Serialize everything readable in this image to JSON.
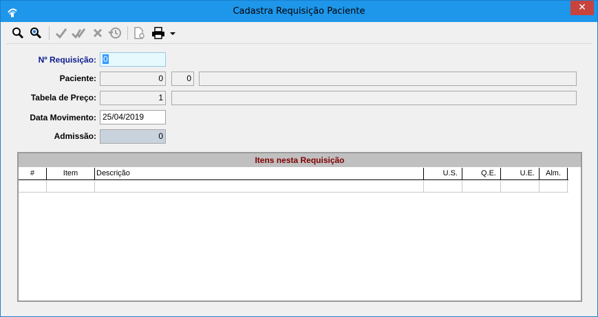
{
  "window": {
    "title": "Cadastra Requisição Paciente",
    "close_glyph": "✕"
  },
  "toolbar": {
    "icons": [
      "search-icon",
      "search-advanced-icon",
      "confirm-icon",
      "confirm-all-icon",
      "cancel-icon",
      "history-icon",
      "new-document-icon",
      "print-icon",
      "dropdown-arrow-icon"
    ]
  },
  "form": {
    "requisicao": {
      "label": "Nº Requisição:",
      "value": "0"
    },
    "paciente": {
      "label": "Paciente:",
      "code": "0",
      "code2": "0",
      "name": ""
    },
    "tabela_preco": {
      "label": "Tabela de Preço:",
      "code": "1",
      "name": ""
    },
    "data_movimento": {
      "label": "Data Movimento:",
      "value": "25/04/2019"
    },
    "admissao": {
      "label": "Admissão:",
      "value": "0"
    }
  },
  "grid": {
    "caption": "Itens nesta Requisição",
    "columns": [
      "#",
      "Item",
      "Descrição",
      "U.S.",
      "Q.E.",
      "U.E.",
      "Alm."
    ],
    "rows": [
      [
        "",
        "",
        "",
        "",
        "",
        "",
        ""
      ]
    ]
  },
  "colors": {
    "title_bar": "#1e96ea",
    "caption_text": "#800000",
    "label_blue": "#0a1b8e",
    "close_button": "#c7433c"
  }
}
